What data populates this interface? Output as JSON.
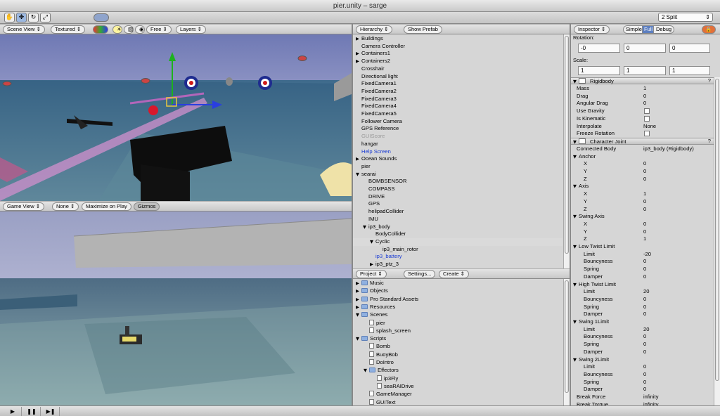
{
  "window": {
    "title": "pier.unity – sarge"
  },
  "toolbar": {
    "tools": [
      {
        "name": "hand-tool",
        "glyph": "✋"
      },
      {
        "name": "move-tool",
        "glyph": "✥"
      },
      {
        "name": "rotate-tool",
        "glyph": "↻"
      },
      {
        "name": "scale-tool",
        "glyph": "⤢"
      }
    ],
    "layout_select": "2 Split"
  },
  "scene_view": {
    "tab": "Scene View",
    "render_mode": "Textured",
    "camera_mode": "Free",
    "layers": "Layers"
  },
  "game_view": {
    "tab": "Game View",
    "aspect": "None",
    "maximize": "Maximize on Play",
    "gizmos": "Gizmos"
  },
  "hierarchy": {
    "tab": "Hierarchy",
    "show_prefab": "Show Prefab",
    "items": [
      {
        "label": "Buildings",
        "indent": 0,
        "arrow": "▶"
      },
      {
        "label": "Camera Controller",
        "indent": 0
      },
      {
        "label": "Containers1",
        "indent": 0,
        "arrow": "▶"
      },
      {
        "label": "Containers2",
        "indent": 0,
        "arrow": "▶"
      },
      {
        "label": "Crosshair",
        "indent": 0
      },
      {
        "label": "Directional light",
        "indent": 0
      },
      {
        "label": "FixedCamera1",
        "indent": 0
      },
      {
        "label": "FixedCamera2",
        "indent": 0
      },
      {
        "label": "FixedCamera3",
        "indent": 0
      },
      {
        "label": "FixedCamera4",
        "indent": 0
      },
      {
        "label": "FixedCamera5",
        "indent": 0
      },
      {
        "label": "Follower Camera",
        "indent": 0
      },
      {
        "label": "GPS Reference",
        "indent": 0
      },
      {
        "label": "GUIScore",
        "indent": 0,
        "style": "gray"
      },
      {
        "label": "hangar",
        "indent": 0
      },
      {
        "label": "Help Screen",
        "indent": 0,
        "style": "blue"
      },
      {
        "label": "Ocean Sounds",
        "indent": 0,
        "arrow": "▶"
      },
      {
        "label": "pier",
        "indent": 0
      },
      {
        "label": "searai",
        "indent": 0,
        "arrow": "▼"
      },
      {
        "label": "BOMBSENSOR",
        "indent": 1
      },
      {
        "label": "COMPASS",
        "indent": 1
      },
      {
        "label": "DRIVE",
        "indent": 1
      },
      {
        "label": "GPS",
        "indent": 1
      },
      {
        "label": "helipadCollider",
        "indent": 1
      },
      {
        "label": "IMU",
        "indent": 1
      },
      {
        "label": "ip3_body",
        "indent": 1,
        "arrow": "▼"
      },
      {
        "label": "BodyCollider",
        "indent": 2
      },
      {
        "label": "Cyclic",
        "indent": 2,
        "arrow": "▼",
        "selected": true
      },
      {
        "label": "ip3_main_rotor",
        "indent": 3
      },
      {
        "label": "ip3_battery",
        "indent": 2,
        "style": "blue"
      },
      {
        "label": "ip3_ptz_3",
        "indent": 2,
        "arrow": "▶"
      }
    ]
  },
  "project": {
    "tab": "Project",
    "settings": "Settings...",
    "create": "Create",
    "items": [
      {
        "label": "Music",
        "indent": 0,
        "arrow": "▶",
        "kind": "folder"
      },
      {
        "label": "Objects",
        "indent": 0,
        "arrow": "▶",
        "kind": "folder"
      },
      {
        "label": "Pro Standard Assets",
        "indent": 0,
        "arrow": "▶",
        "kind": "folder"
      },
      {
        "label": "Resources",
        "indent": 0,
        "arrow": "▶",
        "kind": "folder"
      },
      {
        "label": "Scenes",
        "indent": 0,
        "arrow": "▼",
        "kind": "folder"
      },
      {
        "label": "pier",
        "indent": 1,
        "kind": "scene"
      },
      {
        "label": "splash_screen",
        "indent": 1,
        "kind": "scene"
      },
      {
        "label": "Scripts",
        "indent": 0,
        "arrow": "▼",
        "kind": "folder"
      },
      {
        "label": "Bomb",
        "indent": 1,
        "kind": "file"
      },
      {
        "label": "BuoyBob",
        "indent": 1,
        "kind": "file"
      },
      {
        "label": "DoIntro",
        "indent": 1,
        "kind": "file"
      },
      {
        "label": "Effectors",
        "indent": 1,
        "arrow": "▼",
        "kind": "folder"
      },
      {
        "label": "ip3Fly",
        "indent": 2,
        "kind": "file"
      },
      {
        "label": "seaRAIDrive",
        "indent": 2,
        "kind": "file"
      },
      {
        "label": "GameManager",
        "indent": 1,
        "kind": "file"
      },
      {
        "label": "GUIText",
        "indent": 1,
        "kind": "file"
      }
    ]
  },
  "inspector": {
    "tab": "Inspector",
    "modes": [
      "Simple",
      "Full",
      "Debug"
    ],
    "rotation_label": "Rotation:",
    "rotation": [
      "-0",
      "0",
      "0"
    ],
    "scale_label": "Scale:",
    "scale": [
      "1",
      "1",
      "1"
    ],
    "rigidbody": {
      "header": "Rigidbody",
      "help": "?",
      "rows": [
        {
          "label": "Mass",
          "value": "1"
        },
        {
          "label": "Drag",
          "value": "0"
        },
        {
          "label": "Angular Drag",
          "value": "0"
        },
        {
          "label": "Use Gravity",
          "check": true
        },
        {
          "label": "Is Kinematic",
          "check": true
        },
        {
          "label": "Interpolate",
          "value": "None"
        },
        {
          "label": "Freeze Rotation",
          "check": true
        }
      ]
    },
    "joint": {
      "header": "Character Joint",
      "help": "?",
      "rows": [
        {
          "label": "Connected Body",
          "value": "ip3_body (Rigidbody)",
          "indent": 0
        },
        {
          "label": "Anchor",
          "indent": 0,
          "arrow": "▼"
        },
        {
          "label": "X",
          "value": "0",
          "indent": 2
        },
        {
          "label": "Y",
          "value": "0",
          "indent": 2
        },
        {
          "label": "Z",
          "value": "0",
          "indent": 2
        },
        {
          "label": "Axis",
          "indent": 0,
          "arrow": "▼"
        },
        {
          "label": "X",
          "value": "1",
          "indent": 2
        },
        {
          "label": "Y",
          "value": "0",
          "indent": 2
        },
        {
          "label": "Z",
          "value": "0",
          "indent": 2
        },
        {
          "label": "Swing Axis",
          "indent": 0,
          "arrow": "▼"
        },
        {
          "label": "X",
          "value": "0",
          "indent": 2
        },
        {
          "label": "Y",
          "value": "0",
          "indent": 2
        },
        {
          "label": "Z",
          "value": "1",
          "indent": 2
        },
        {
          "label": "Low Twist Limit",
          "indent": 0,
          "arrow": "▼"
        },
        {
          "label": "Limit",
          "value": "-20",
          "indent": 2
        },
        {
          "label": "Bouncyness",
          "value": "0",
          "indent": 2
        },
        {
          "label": "Spring",
          "value": "0",
          "indent": 2
        },
        {
          "label": "Damper",
          "value": "0",
          "indent": 2
        },
        {
          "label": "High Twist Limit",
          "indent": 0,
          "arrow": "▼"
        },
        {
          "label": "Limit",
          "value": "20",
          "indent": 2
        },
        {
          "label": "Bouncyness",
          "value": "0",
          "indent": 2
        },
        {
          "label": "Spring",
          "value": "0",
          "indent": 2
        },
        {
          "label": "Damper",
          "value": "0",
          "indent": 2
        },
        {
          "label": "Swing 1Limit",
          "indent": 0,
          "arrow": "▼"
        },
        {
          "label": "Limit",
          "value": "20",
          "indent": 2
        },
        {
          "label": "Bouncyness",
          "value": "0",
          "indent": 2
        },
        {
          "label": "Spring",
          "value": "0",
          "indent": 2
        },
        {
          "label": "Damper",
          "value": "0",
          "indent": 2
        },
        {
          "label": "Swing 2Limit",
          "indent": 0,
          "arrow": "▼"
        },
        {
          "label": "Limit",
          "value": "0",
          "indent": 2
        },
        {
          "label": "Bouncyness",
          "value": "0",
          "indent": 2
        },
        {
          "label": "Spring",
          "value": "0",
          "indent": 2
        },
        {
          "label": "Damper",
          "value": "0",
          "indent": 2
        },
        {
          "label": "Break Force",
          "value": "infinity",
          "indent": 0
        },
        {
          "label": "Break Torque",
          "value": "infinity",
          "indent": 0
        }
      ]
    }
  },
  "playback": {
    "play": "▶",
    "pause": "❚❚",
    "step": "▶❚"
  },
  "colors": {
    "accent": "#1b3cd3",
    "sky_top": "#7e86b8",
    "sky_bottom": "#c9c7e0",
    "water": "#4a7090"
  }
}
